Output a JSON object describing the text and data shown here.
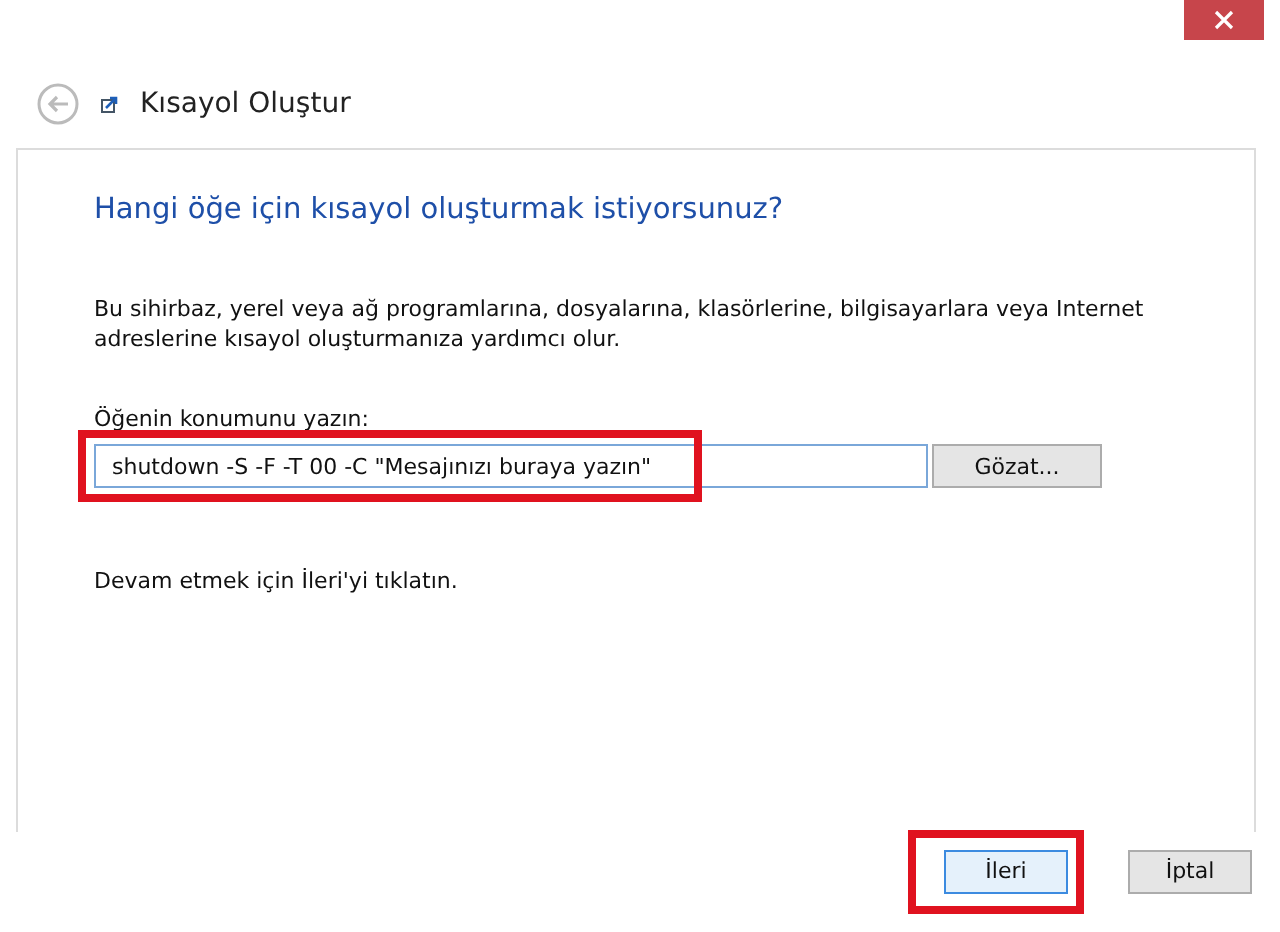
{
  "window": {
    "title": "Kısayol Oluştur"
  },
  "heading": "Hangi öğe için kısayol oluşturmak istiyorsunuz?",
  "description": "Bu sihirbaz, yerel veya ağ programlarına, dosyalarına, klasörlerine, bilgisayarlara veya Internet adreslerine kısayol oluşturmanıza yardımcı olur.",
  "location": {
    "label": "Öğenin konumunu yazın:",
    "value": "shutdown -S -F -T 00 -C \"Mesajınızı buraya yazın\"",
    "browse_button": "Gözat..."
  },
  "hint": "Devam etmek için İleri'yi tıklatın.",
  "buttons": [
    {
      "label": "İleri",
      "selected": true
    },
    {
      "label": "İptal",
      "selected": false
    }
  ]
}
